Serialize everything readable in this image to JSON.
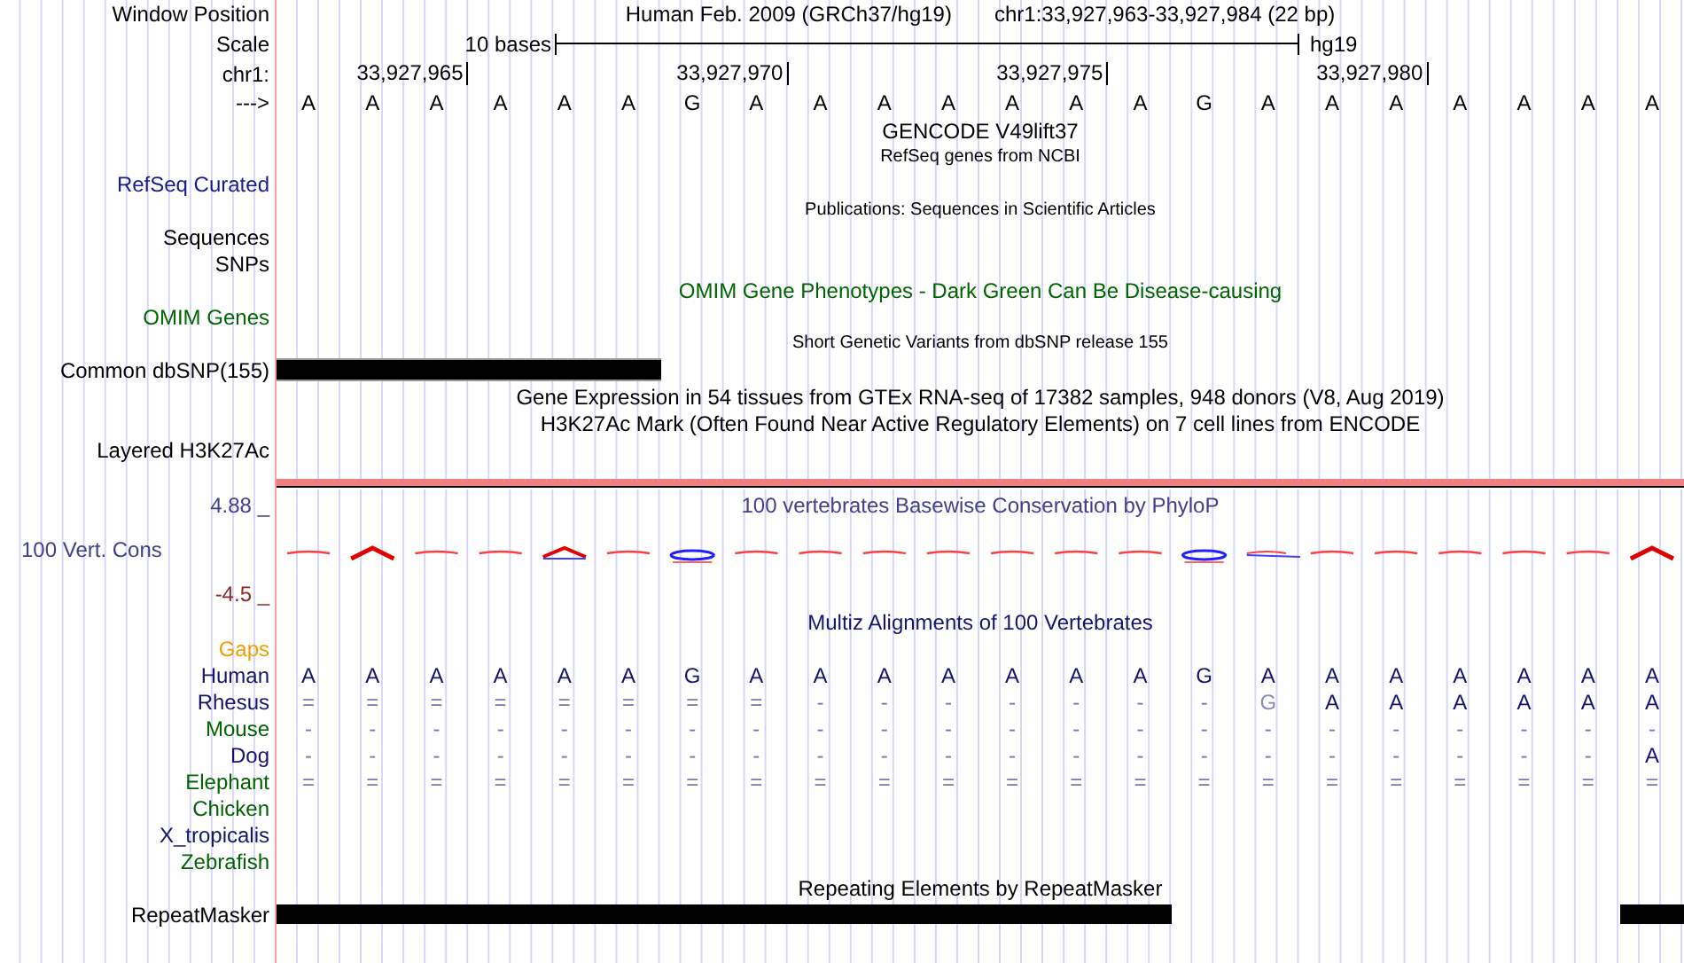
{
  "position": {
    "label": "Window Position",
    "assembly": "Human Feb. 2009 (GRCh37/hg19)",
    "range": "chr1:33,927,963-33,927,984 (22 bp)"
  },
  "scale": {
    "label": "Scale",
    "length": "10 bases",
    "genome": "hg19"
  },
  "coordinates": {
    "label": "chr1:",
    "ticks": [
      "33,927,965",
      "33,927,970",
      "33,927,975",
      "33,927,980"
    ]
  },
  "sequence": {
    "label": "--->",
    "bases": [
      "A",
      "A",
      "A",
      "A",
      "A",
      "A",
      "G",
      "A",
      "A",
      "A",
      "A",
      "A",
      "A",
      "A",
      "G",
      "A",
      "A",
      "A",
      "A",
      "A",
      "A",
      "A"
    ]
  },
  "tracks": [
    {
      "kind": "title",
      "text": "GENCODE V49lift37",
      "color": "#000000"
    },
    {
      "kind": "subtitle",
      "text": "RefSeq genes from NCBI"
    },
    {
      "kind": "label",
      "label": "RefSeq Curated",
      "color": "#1a1a8c"
    },
    {
      "kind": "subtitle",
      "text": "Publications: Sequences in Scientific Articles"
    },
    {
      "kind": "label",
      "label": "Sequences",
      "color": "#000000"
    },
    {
      "kind": "label",
      "label": "SNPs",
      "color": "#000000"
    },
    {
      "kind": "title",
      "text": "OMIM Gene Phenotypes - Dark Green Can Be Disease-causing",
      "color": "#006400"
    },
    {
      "kind": "label",
      "label": "OMIM Genes",
      "color": "#006400"
    },
    {
      "kind": "subtitle",
      "text": "Short Genetic Variants from dbSNP release 155"
    },
    {
      "kind": "bar",
      "label": "Common dbSNP(155)",
      "color": "#000000"
    },
    {
      "kind": "title",
      "text": "Gene Expression in 54 tissues from GTEx RNA-seq of 17382 samples, 948 donors (V8, Aug 2019)",
      "color": "#000000"
    },
    {
      "kind": "title",
      "text": "H3K27Ac Mark (Often Found Near Active Regulatory Elements) on 7 cell lines from ENCODE",
      "color": "#000000"
    },
    {
      "kind": "label",
      "label": "Layered H3K27Ac",
      "color": "#000000"
    },
    {
      "kind": "divider"
    },
    {
      "kind": "conservation",
      "label": "100 Vert. Cons",
      "max": "4.88 _",
      "min": "-4.5 _",
      "title": "100 vertebrates Basewise Conservation by PhyloP",
      "color": "#40408c"
    },
    {
      "kind": "title",
      "text": "Multiz Alignments of 100 Vertebrates",
      "color": "#14146e"
    },
    {
      "kind": "label",
      "label": "Gaps",
      "color": "#f0a000"
    },
    {
      "kind": "species",
      "label": "Human",
      "color": "#14146e",
      "sequence": [
        "A",
        "A",
        "A",
        "A",
        "A",
        "A",
        "G",
        "A",
        "A",
        "A",
        "A",
        "A",
        "A",
        "A",
        "G",
        "A",
        "A",
        "A",
        "A",
        "A",
        "A",
        "A"
      ]
    },
    {
      "kind": "species",
      "label": "Rhesus",
      "color": "#14146e",
      "sequence": [
        "=",
        "=",
        "=",
        "=",
        "=",
        "=",
        "=",
        "=",
        "-",
        "-",
        "-",
        "-",
        "-",
        "-",
        "-",
        "G",
        "A",
        "A",
        "A",
        "A",
        "A",
        "A"
      ]
    },
    {
      "kind": "species",
      "label": "Mouse",
      "color": "#006400",
      "sequence": [
        "-",
        "-",
        "-",
        "-",
        "-",
        "-",
        "-",
        "-",
        "-",
        "-",
        "-",
        "-",
        "-",
        "-",
        "-",
        "-",
        "-",
        "-",
        "-",
        "-",
        "-",
        "-"
      ]
    },
    {
      "kind": "species",
      "label": "Dog",
      "color": "#14146e",
      "sequence": [
        "-",
        "-",
        "-",
        "-",
        "-",
        "-",
        "-",
        "-",
        "-",
        "-",
        "-",
        "-",
        "-",
        "-",
        "-",
        "-",
        "-",
        "-",
        "-",
        "-",
        "-",
        "A"
      ]
    },
    {
      "kind": "species",
      "label": "Elephant",
      "color": "#006400",
      "sequence": [
        "=",
        "=",
        "=",
        "=",
        "=",
        "=",
        "=",
        "=",
        "=",
        "=",
        "=",
        "=",
        "=",
        "=",
        "=",
        "=",
        "=",
        "=",
        "=",
        "=",
        "=",
        "="
      ]
    },
    {
      "kind": "species",
      "label": "Chicken",
      "color": "#006400"
    },
    {
      "kind": "species",
      "label": "X_tropicalis",
      "color": "#14146e"
    },
    {
      "kind": "species",
      "label": "Zebrafish",
      "color": "#006400"
    },
    {
      "kind": "title",
      "text": "Repeating Elements by RepeatMasker",
      "color": "#000000"
    },
    {
      "kind": "bar",
      "label": "RepeatMasker",
      "color": "#000000"
    }
  ]
}
